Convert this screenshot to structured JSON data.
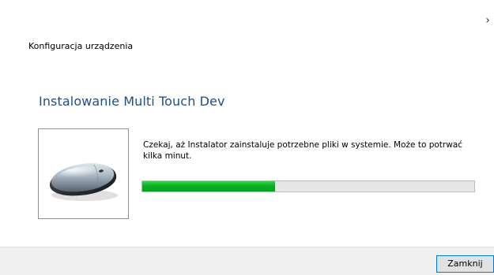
{
  "window": {
    "title": "Konfiguracja urządzenia"
  },
  "main": {
    "heading": "Instalowanie Multi Touch Dev",
    "message": "Czekaj, aż Instalator zainstaluje potrzebne pliki w systemie. Może to potrwać kilka minut.",
    "device_icon": "mouse-icon",
    "progress_percent": 40
  },
  "footer": {
    "close_label": "Zamknij"
  },
  "icons": {
    "title_bar_close": "chevron-right-icon"
  },
  "colors": {
    "heading": "#1f4e8c",
    "progress_fill": "#06b025",
    "progress_track": "#e6e6e6",
    "button_border": "#0078d7",
    "footer_bg": "#f0f0f0"
  }
}
